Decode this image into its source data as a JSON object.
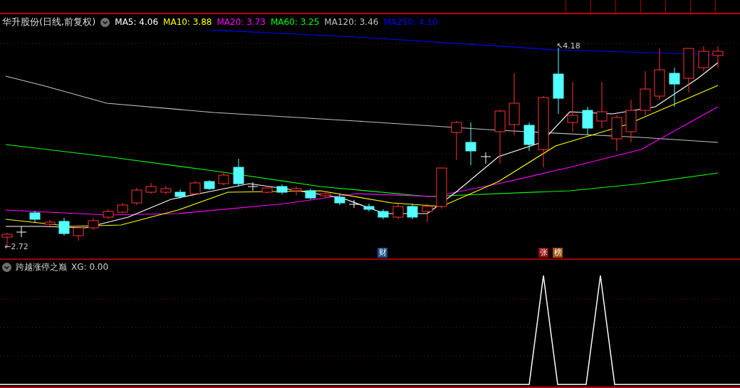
{
  "chart_header": {
    "title": "华升股份(日线,前复权)",
    "moving_averages": [
      {
        "label": "MA5:",
        "value": "4.06",
        "color": "#ffffff"
      },
      {
        "label": "MA10:",
        "value": "3.88",
        "color": "#ffff00"
      },
      {
        "label": "MA20:",
        "value": "3.73",
        "color": "#ff00ff"
      },
      {
        "label": "MA60:",
        "value": "3.25",
        "color": "#00ff00"
      },
      {
        "label": "MA120:",
        "value": "3.46",
        "color": "#c0c0c0"
      },
      {
        "label": "MA250:",
        "value": "4.10",
        "color": "#0000ff"
      }
    ]
  },
  "price_chart": {
    "high_label": "↖4.18",
    "low_label": "←2.72",
    "event_badges": [
      {
        "text": "财",
        "color": "#1f4f8a"
      },
      {
        "text": "张",
        "color": "#8b0a0a"
      },
      {
        "text": "榜",
        "color": "#a0520f"
      }
    ]
  },
  "indicator": {
    "name": "跨越涨停之巅",
    "reading": "XG: 0.00"
  }
}
